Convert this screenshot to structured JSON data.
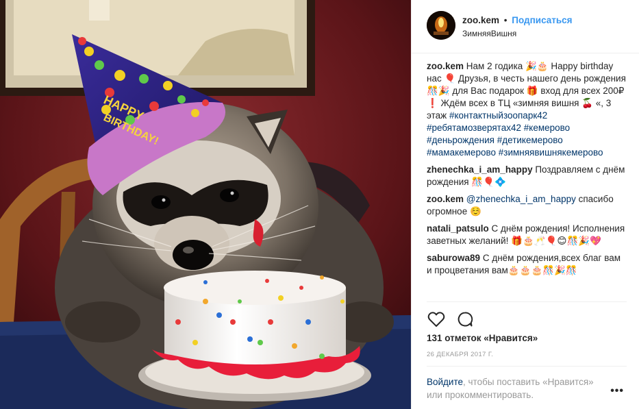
{
  "header": {
    "username": "zoo.kem",
    "separator": "•",
    "follow_label": "Подписаться",
    "location": "ЗимняяВишня"
  },
  "caption": {
    "username": "zoo.kem",
    "text": "Нам 2 годика 🎉🎂 Happy birthday нас 🎈 Друзья, в честь нашего день рождения🎊🎉 для Вас подарок 🎁 вход для всех 200₽ ❗ Ждём всех в ТЦ «зимняя вишня 🍒 «, 3 этаж",
    "hashtags": [
      "#контактныйзоопарк42",
      "#ребятамозверятах42",
      "#кемерово",
      "#деньрождения",
      "#детикемерово",
      "#мамакемерово",
      "#зимняявишнякемерово"
    ]
  },
  "comments": [
    {
      "username": "zhenechka_i_am_happy",
      "text": "Поздравляем с днём рождения 🎊🎈💠"
    },
    {
      "username": "zoo.kem",
      "mention": "@zhenechka_i_am_happy",
      "text": "спасибо огромное ☺️"
    },
    {
      "username": "natali_patsulo",
      "text": "С днём рождения! Исполнения заветных желаний! 🎁🎂🥂🎈😊🎊🎉💖"
    },
    {
      "username": "saburowa89",
      "text": "С днём рождения,всех благ вам и процветания вам🎂🎂🎂🎊🎉🎊"
    }
  ],
  "actions": {
    "like_icon": "heart-icon",
    "comment_icon": "comment-bubble-icon"
  },
  "likes": {
    "text": "131 отметок «Нравится»"
  },
  "date": {
    "text": "26 ДЕКАБРЯ 2017 Г."
  },
  "login_prompt": {
    "link": "Войдите",
    "text": ", чтобы поставить «Нравится» или прокомментировать."
  },
  "more_options": {
    "label": "•••"
  },
  "colors": {
    "link": "#003569",
    "follow": "#3897f0",
    "muted": "#999999",
    "border": "#efefef"
  }
}
